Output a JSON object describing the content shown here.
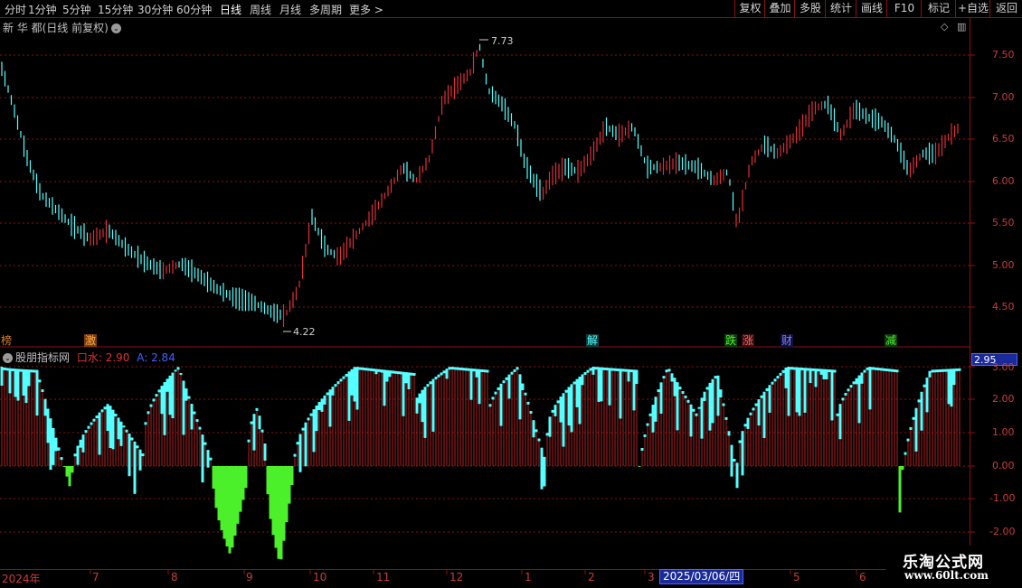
{
  "toolbar": {
    "left": [
      "分时",
      "1分钟",
      "5分钟",
      "15分钟",
      "30分钟",
      "60分钟",
      "日线",
      "周线",
      "月线",
      "多周期",
      "更多 >"
    ],
    "right": [
      "复权",
      "叠加",
      "多股",
      "统计",
      "画线",
      "F10",
      "标记",
      "+自选",
      "返回"
    ],
    "active": "日线"
  },
  "main": {
    "title": "新 华 都(日线 前复权)",
    "price_ticks": [
      "7.50",
      "7.00",
      "6.50",
      "6.00",
      "5.50",
      "5.00",
      "4.50"
    ],
    "high_label": "7.73",
    "low_label": "4.22"
  },
  "signals": [
    "榜",
    "激",
    "解",
    "跌",
    "涨",
    "财",
    "减"
  ],
  "indicator": {
    "name": "股朋指标网",
    "line1_label": "口水: 2.90",
    "line2_label": "A: 2.84",
    "current_value": "2.95",
    "ticks": [
      "3.00",
      "2.00",
      "1.00",
      "0.00",
      "-1.00",
      "-2.00"
    ]
  },
  "date_axis": {
    "labels": [
      "2024年",
      "7",
      "8",
      "9",
      "10",
      "11",
      "12",
      "1",
      "2",
      "3",
      "5",
      "6"
    ],
    "cursor_date": "2025/03/06/四"
  },
  "watermark": {
    "line1": "乐淘公式网",
    "line2": "www.60lt.com"
  },
  "colors": {
    "up": "#e0303a",
    "down": "#54ffff",
    "negative": "#4cf02a",
    "grid": "#8b1010",
    "axis_text": "#c83c3c"
  }
}
